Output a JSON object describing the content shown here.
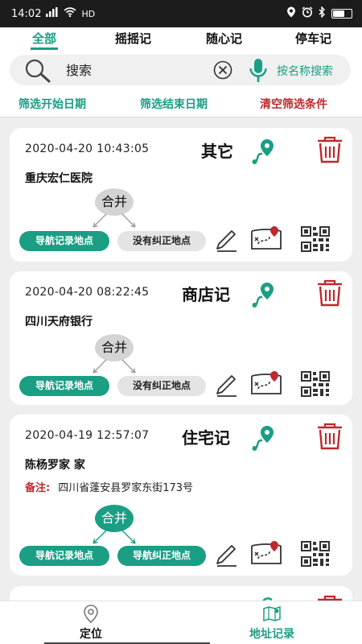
{
  "status_bar": {
    "time": "14:02",
    "network": "HD"
  },
  "tabs": [
    {
      "label": "全部",
      "active": true
    },
    {
      "label": "摇摇记",
      "active": false
    },
    {
      "label": "随心记",
      "active": false
    },
    {
      "label": "停车记",
      "active": false
    }
  ],
  "search": {
    "placeholder": "搜索",
    "by_name_label": "按名称搜索"
  },
  "filters": {
    "start_date": "筛选开始日期",
    "end_date": "筛选结束日期",
    "clear": "清空筛选条件"
  },
  "records": [
    {
      "datetime": "2020-04-20 10:43:05",
      "category": "其它",
      "name": "重庆宏仁医院",
      "merge_label": "合并",
      "nav_record_label": "导航记录地点",
      "corrected_label": "没有纠正地点"
    },
    {
      "datetime": "2020-04-20 08:22:45",
      "category": "商店记",
      "name": "四川天府银行",
      "merge_label": "合并",
      "nav_record_label": "导航记录地点",
      "corrected_label": "没有纠正地点"
    },
    {
      "datetime": "2020-04-19 12:57:07",
      "category": "住宅记",
      "name": "陈杨罗家 家",
      "note_label": "备注:",
      "note": "四川省蓬安县罗家东街173号",
      "merge_label": "合并",
      "nav_record_label": "导航记录地点",
      "corrected_label": "导航纠正地点"
    }
  ],
  "bottom_nav": [
    {
      "label": "定位",
      "active": false
    },
    {
      "label": "地址记录",
      "active": true
    }
  ],
  "colors": {
    "accent": "#1a9e84",
    "danger": "#c0282c",
    "status_bar": "#1c1c1c"
  }
}
